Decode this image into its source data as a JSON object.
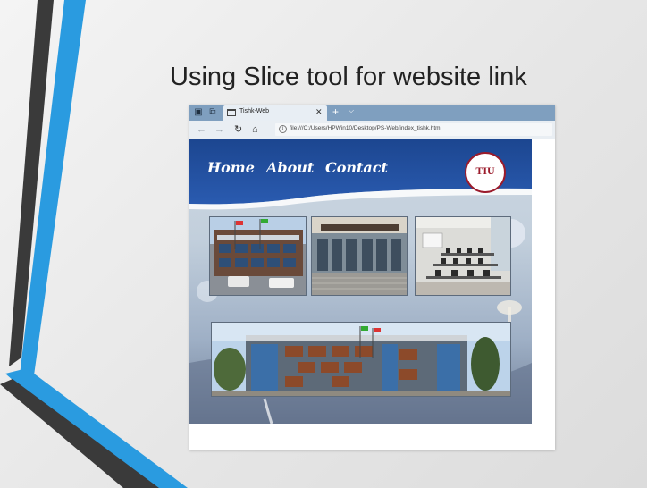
{
  "slide": {
    "title": "Using Slice tool for website link"
  },
  "browser": {
    "tab_title": "Tishk-Web",
    "address_url": "file:///C:/Users/HPWin10/Desktop/PS-Web/index_tishk.html",
    "icons": {
      "tab_actions": "tab-actions-icon",
      "set_aside": "set-aside-tabs-icon",
      "close": "close-icon",
      "new_tab": "plus-icon",
      "tab_menu": "chevron-down-icon",
      "back": "back-arrow-icon",
      "forward": "forward-arrow-icon",
      "refresh": "refresh-icon",
      "home": "home-icon",
      "info": "info-icon"
    }
  },
  "website": {
    "nav": {
      "home": "Home",
      "about": "About",
      "contact": "Contact"
    },
    "logo_text": "TIU",
    "header_color": "#1f4e99",
    "logo_color": "#9b1b2b"
  },
  "colors": {
    "slide_stripe_blue": "#2a9be0",
    "slide_stripe_dark": "#3a3a3a",
    "tab_bar": "#7f9fbf"
  }
}
